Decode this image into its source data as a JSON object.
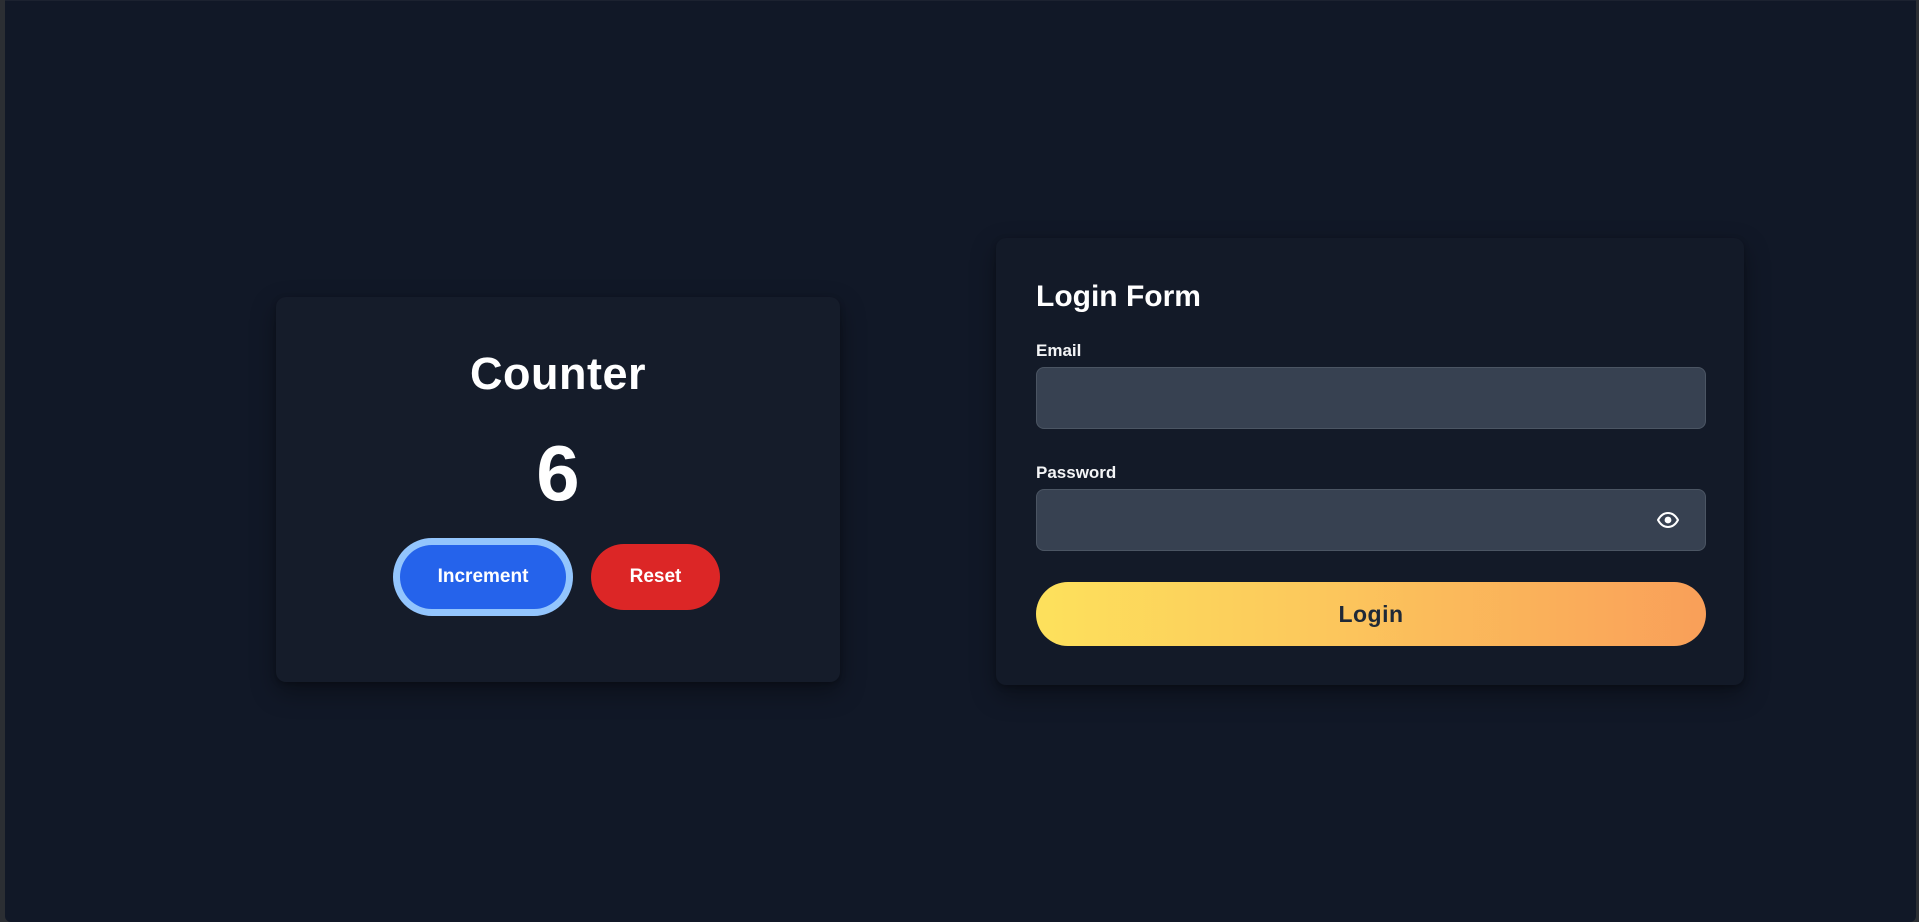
{
  "counter": {
    "title": "Counter",
    "value": "6",
    "increment_label": "Increment",
    "reset_label": "Reset"
  },
  "login": {
    "title": "Login Form",
    "email_label": "Email",
    "email_value": "",
    "email_placeholder": "",
    "password_label": "Password",
    "password_value": "",
    "password_placeholder": "",
    "submit_label": "Login"
  },
  "icons": {
    "password_toggle": "eye-icon"
  },
  "colors": {
    "background": "#111827",
    "card": "#151c2a",
    "input_bg": "#374151",
    "increment": "#2563eb",
    "increment_ring": "#93c5fd",
    "reset": "#dc2626",
    "login_gradient_start": "#fde15c",
    "login_gradient_end": "#f99f59"
  }
}
